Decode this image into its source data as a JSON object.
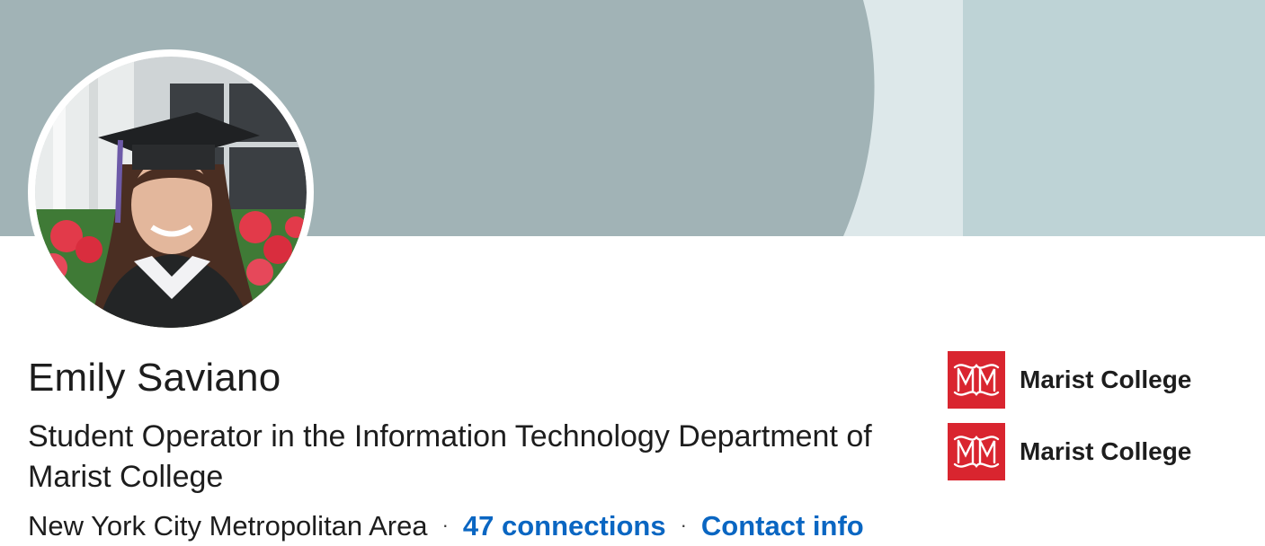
{
  "profile": {
    "name": "Emily Saviano",
    "headline": "Student Operator in the Information Technology Department of Marist College",
    "location": "New York City Metropolitan Area",
    "separator": "·",
    "connections": "47 connections",
    "contact": "Contact info"
  },
  "organizations": [
    {
      "name": "Marist College",
      "icon": "marist-logo-icon"
    },
    {
      "name": "Marist College",
      "icon": "marist-logo-icon"
    }
  ],
  "colors": {
    "banner_main": "#a1b3b6",
    "banner_light": "#dde8ea",
    "banner_right": "#bed3d6",
    "link": "#0a66c2",
    "org_logo": "#d9252f"
  }
}
